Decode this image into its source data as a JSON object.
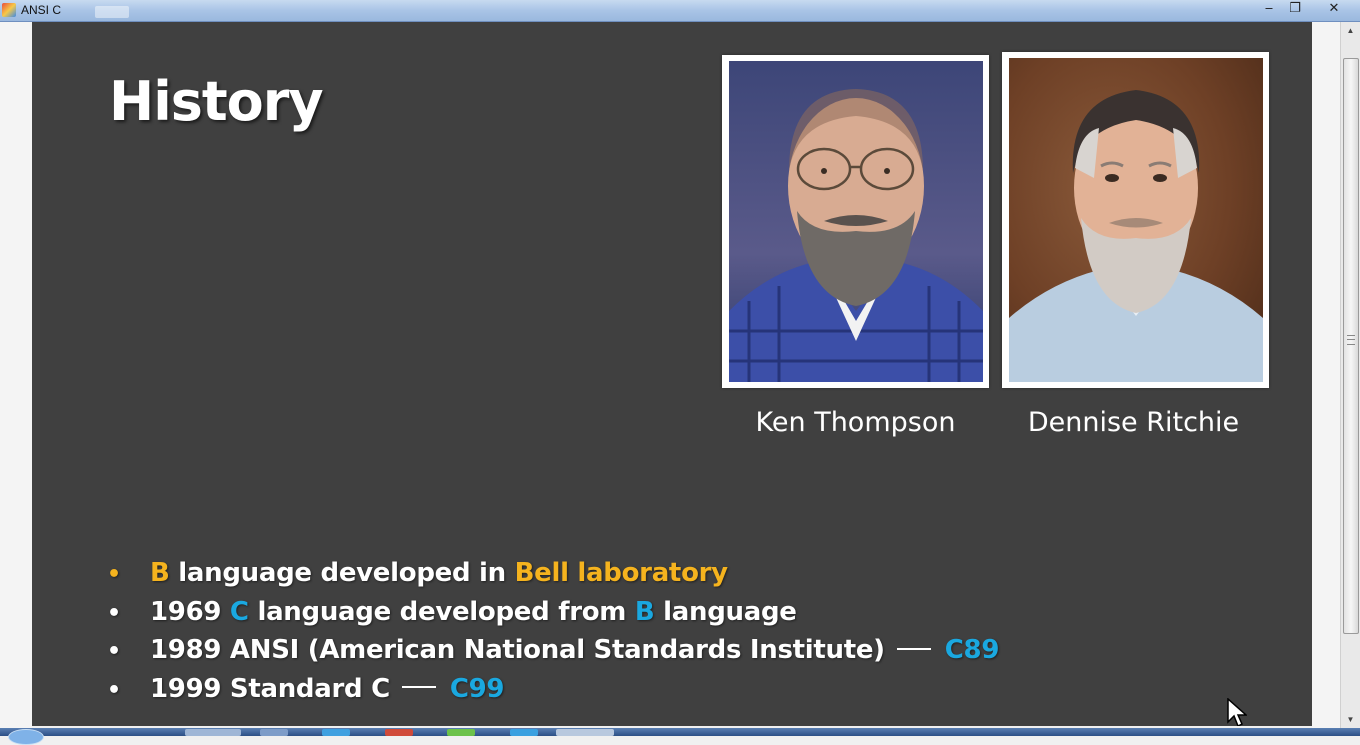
{
  "window": {
    "title": "ANSI C",
    "minimize_glyph": "‒",
    "maximize_glyph": "❐",
    "close_glyph": "✕"
  },
  "slide": {
    "title": "History",
    "photos": [
      {
        "caption": "Ken Thompson"
      },
      {
        "caption": "Dennise Ritchie"
      }
    ],
    "bullets": [
      {
        "bullet": "•",
        "parts": [
          "B",
          " language developed in ",
          "Bell laboratory"
        ]
      },
      {
        "bullet": "•",
        "parts": [
          "1969 ",
          "C",
          " language developed from ",
          "B",
          " language"
        ]
      },
      {
        "bullet": "•",
        "text": "1989 ANSI (American National Standards Institute)",
        "version": "C89"
      },
      {
        "bullet": "•",
        "text": "1999 Standard C",
        "version": "C99"
      }
    ]
  },
  "colors": {
    "slide_background": "#404040",
    "highlight_yellow": "#f5b31e",
    "highlight_blue": "#1aa8e0",
    "text": "#ffffff"
  },
  "icons": {
    "app": "app-icon",
    "scroll_up": "arrow-up-icon",
    "scroll_down": "arrow-down-icon",
    "cursor": "mouse-pointer-icon"
  }
}
